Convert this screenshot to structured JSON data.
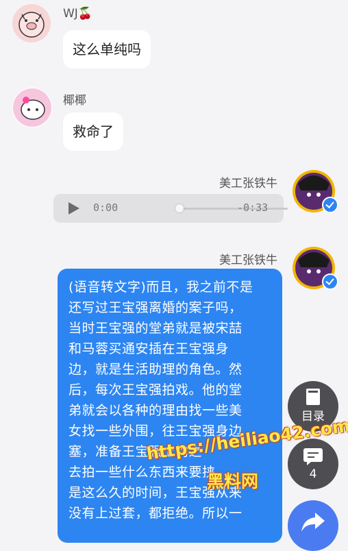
{
  "messages": [
    {
      "sender": "WJ🍒",
      "text": "这么单纯吗"
    },
    {
      "sender": "椰椰",
      "text": "救命了"
    },
    {
      "sender": "美工张铁牛",
      "audio": {
        "current": "0:00",
        "remaining": "-0:33",
        "progress": 0
      }
    },
    {
      "sender": "美工张铁牛",
      "lines": [
        "(语音转文字)而且，我之前不是",
        "还写过王宝强离婚的案子吗，",
        "当时王宝强的堂弟就是被宋喆",
        "和马蓉买通安插在王宝强身",
        "边，就是生活助理的角色。然",
        "后，每次王宝强拍戏。他的堂",
        "弟就会以各种的理由找一些美",
        "女找一些外围，往王宝强身边",
        "塞，准备王宝强上钩之",
        "去拍一些什么东西来要挟",
        "是这么久的时间，王宝强从来",
        "没有上过套，都拒绝。所以一"
      ]
    }
  ],
  "fabs": {
    "toc": {
      "label": "目录",
      "icon": "book-icon"
    },
    "comments": {
      "label": "4",
      "icon": "comment-icon"
    },
    "share": {
      "icon": "share-icon"
    }
  },
  "watermark": {
    "url": "https://heiliao42.com",
    "site": "黑料网"
  }
}
